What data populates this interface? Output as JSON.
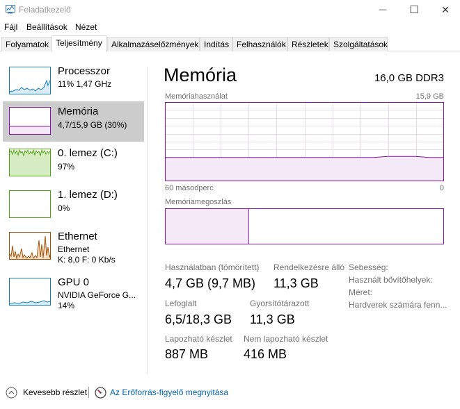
{
  "window": {
    "title": "Feladatkezelő",
    "icon": "task-manager-icon",
    "minimize_glyph": "—",
    "maximize_glyph": "☐",
    "close_glyph": "✕"
  },
  "menu": [
    "Fájl",
    "Beállítások",
    "Nézet"
  ],
  "tabs": [
    "Folyamatok",
    "Teljesítmény",
    "Alkalmazáselőzmények",
    "Indítás",
    "Felhasználók",
    "Részletek",
    "Szolgáltatások"
  ],
  "active_tab": "Teljesítmény",
  "sidebar": [
    {
      "title": "Processzor",
      "line1": "11% 1,47 GHz",
      "line2": "",
      "color": "#117dbb",
      "selected": false
    },
    {
      "title": "Memória",
      "line1": "4,7/15,9 GB (30%)",
      "line2": "",
      "color": "#8b12ae",
      "selected": true
    },
    {
      "title": "0. lemez (C:)",
      "line1": "97%",
      "line2": "",
      "color": "#4da60c",
      "selected": false
    },
    {
      "title": "1. lemez (D:)",
      "line1": "0%",
      "line2": "",
      "color": "#4da60c",
      "selected": false
    },
    {
      "title": "Ethernet",
      "line1": "Ethernet",
      "line2": "K: 8,0  F: 0 Kb/s",
      "color": "#a74f01",
      "selected": false
    },
    {
      "title": "GPU 0",
      "line1": "NVIDIA GeForce G...",
      "line2": "14%",
      "color": "#117dbb",
      "selected": false
    }
  ],
  "main": {
    "title": "Memória",
    "spec": "16,0 GB DDR3",
    "usage_label": "Memóriahasználat",
    "usage_max": "15,9 GB",
    "time_left": "60 másodperc",
    "time_right": "0",
    "composition_label": "Memóriamegoszlás",
    "usage_level": 0.3,
    "composition_in_use": 0.3,
    "accent": "#8b12ae"
  },
  "stats": {
    "in_use_label": "Használatban (tömörített)",
    "in_use_value": "4,7 GB (9,7 MB)",
    "available_label": "Rendelkezésre álló",
    "available_value": "11,3 GB",
    "committed_label": "Lefoglalt",
    "committed_value": "6,5/18,3 GB",
    "cached_label": "Gyorsítótárazott",
    "cached_value": "11,3 GB",
    "paged_label": "Lapozható készlet",
    "paged_value": "887 MB",
    "nonpaged_label": "Nem lapozható készlet",
    "nonpaged_value": "416 MB"
  },
  "info": [
    "Sebesség:",
    "Használt bővítőhelyek:",
    "Méret:",
    "Hardverek számára fenn..."
  ],
  "footer": {
    "less_details": "Kevesebb részlet",
    "resource_monitor": "Az Erőforrás-figyelő megnyitása"
  }
}
